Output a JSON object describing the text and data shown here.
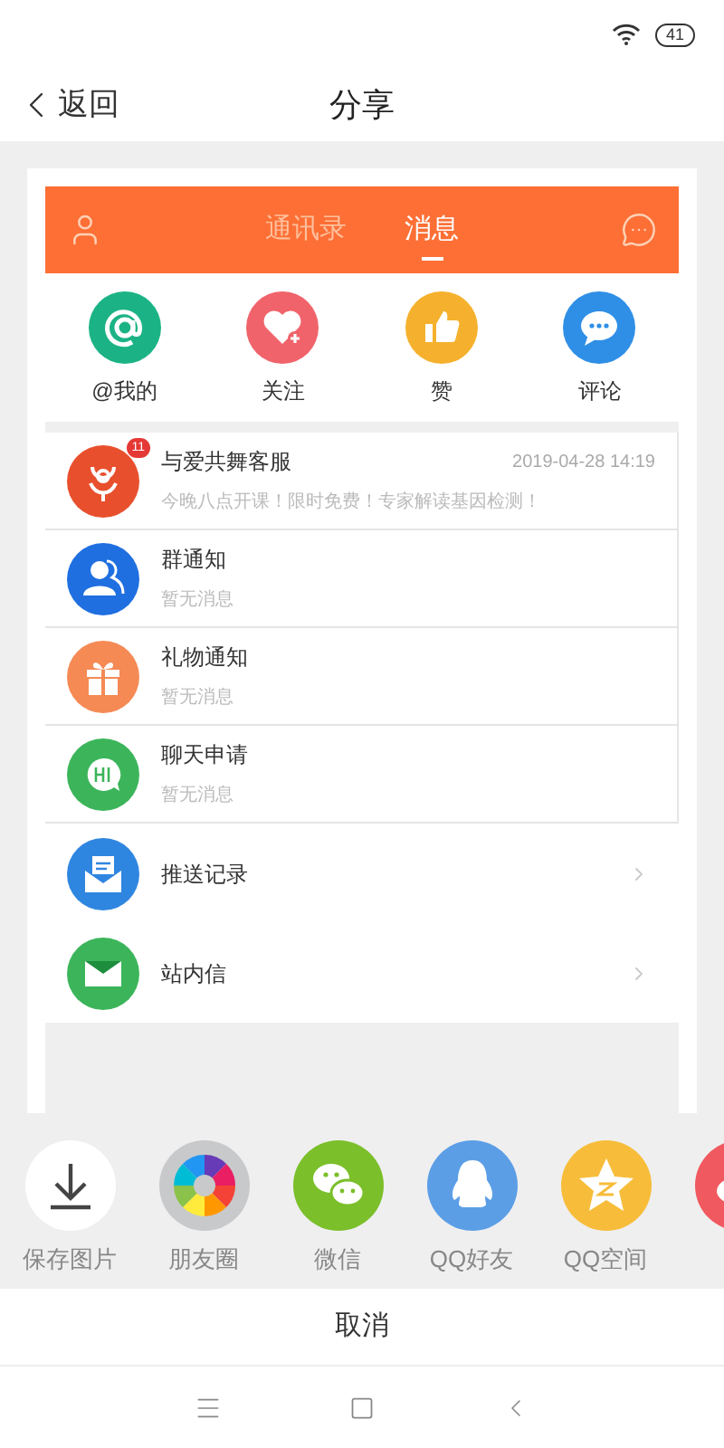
{
  "status_bar": {
    "battery": "41"
  },
  "header": {
    "back": "返回",
    "title": "分享"
  },
  "app_tabs": [
    {
      "label": "通讯录",
      "selected": false
    },
    {
      "label": "消息",
      "selected": true
    }
  ],
  "shortcuts": [
    {
      "kind": "at",
      "label": "@我的"
    },
    {
      "kind": "heart",
      "label": "关注"
    },
    {
      "kind": "thumb",
      "label": "赞"
    },
    {
      "kind": "comment",
      "label": "评论"
    }
  ],
  "messages": [
    {
      "kind": "service",
      "title": "与爱共舞客服",
      "badge": "11",
      "time": "2019-04-28 14:19",
      "preview": "今晚八点开课！限时免费！专家解读基因检测！"
    },
    {
      "kind": "group",
      "title": "群通知",
      "preview": "暂无消息"
    },
    {
      "kind": "gift",
      "title": "礼物通知",
      "preview": "暂无消息"
    },
    {
      "kind": "chat",
      "title": "聊天申请",
      "preview": "暂无消息"
    }
  ],
  "links": [
    {
      "kind": "push",
      "title": "推送记录"
    },
    {
      "kind": "mail",
      "title": "站内信"
    }
  ],
  "share_targets": [
    {
      "kind": "download",
      "label": "保存图片"
    },
    {
      "kind": "moments",
      "label": "朋友圈"
    },
    {
      "kind": "wechat",
      "label": "微信"
    },
    {
      "kind": "qq",
      "label": "QQ好友"
    },
    {
      "kind": "qzone",
      "label": "QQ空间"
    },
    {
      "kind": "weibo"
    }
  ],
  "cancel": "取消"
}
